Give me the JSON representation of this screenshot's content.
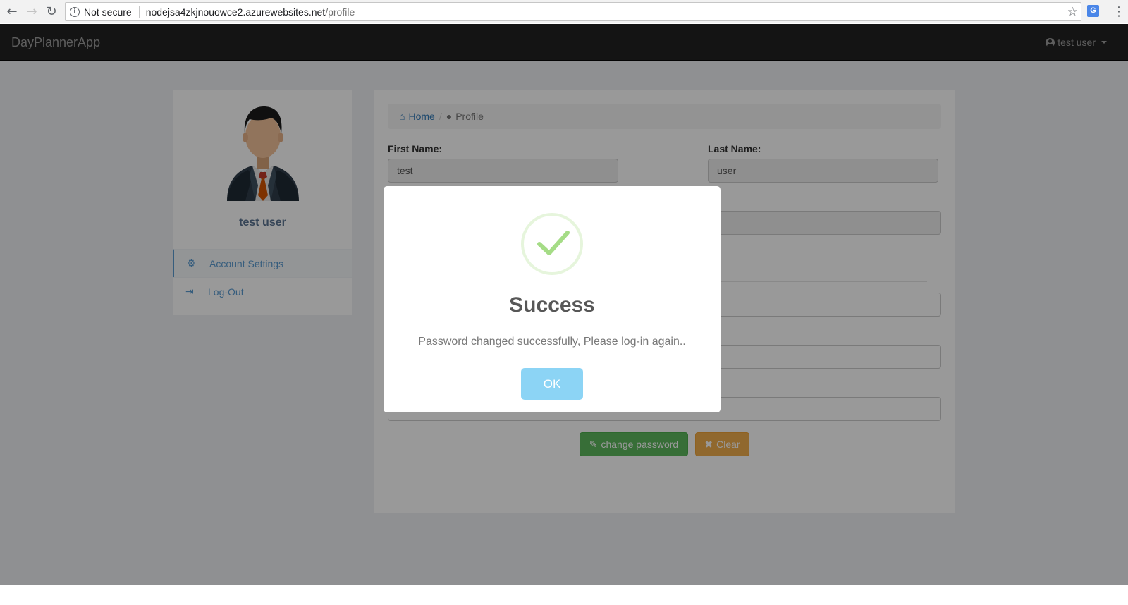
{
  "browser": {
    "security_label": "Not secure",
    "url_host": "nodejsa4zkjnouowce2.azurewebsites.net",
    "url_path": "/profile"
  },
  "navbar": {
    "brand": "DayPlannerApp",
    "user_label": "test user"
  },
  "sidebar": {
    "profile_name": "test user",
    "items": [
      {
        "label": "Account Settings",
        "icon": "gear-icon",
        "active": true
      },
      {
        "label": "Log-Out",
        "icon": "logout-icon",
        "active": false
      }
    ]
  },
  "breadcrumb": {
    "home": "Home",
    "current": "Profile"
  },
  "form": {
    "first_name_label": "First Name:",
    "first_name_value": "test",
    "last_name_label": "Last Name:",
    "last_name_value": "user",
    "change_password_label": "change password",
    "clear_label": "Clear"
  },
  "modal": {
    "title": "Success",
    "message": "Password changed successfully, Please log-in again..",
    "ok_label": "OK"
  },
  "colors": {
    "navbar": "#222222",
    "link": "#337ab7",
    "success": "#5cb85c",
    "warning": "#f0ad4e",
    "ok_button": "#8cd4f5",
    "check": "#a5dc86"
  }
}
